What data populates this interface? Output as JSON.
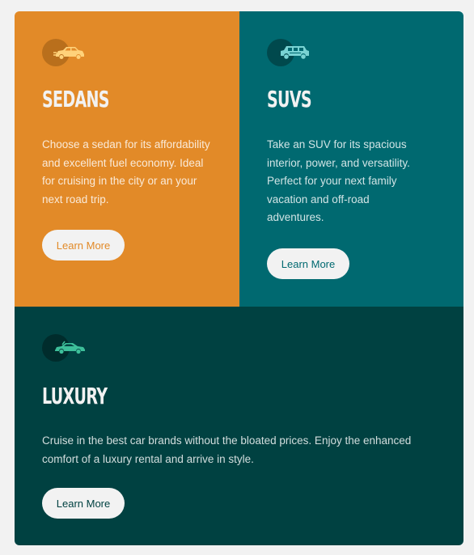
{
  "cards": [
    {
      "icon": "sedan-car-icon",
      "title": "SEDANS",
      "text": "Choose a sedan for its affordability and excellent fuel economy. Ideal for cruising in the city or an your next road trip.",
      "button": "Learn More",
      "background": "#e28a28"
    },
    {
      "icon": "suv-car-icon",
      "title": "SUVS",
      "text": "Take an SUV for its spacious interior, power, and versatility. Perfect for your next family vacation and off-road adventures.",
      "button": "Learn More",
      "background": "#006970"
    },
    {
      "icon": "luxury-car-icon",
      "title": "LUXURY",
      "text": "Cruise in the best car brands without the bloated prices. Enjoy the enhanced comfort of a luxury rental and arrive in style.",
      "button": "Learn More",
      "background": "#004141"
    }
  ],
  "colors": {
    "page_background": "#f2f2f2",
    "text_light": "#f2f2f2"
  }
}
